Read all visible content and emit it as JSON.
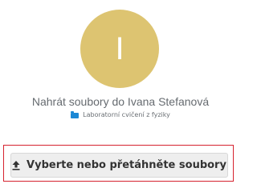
{
  "avatar": {
    "initial": "I"
  },
  "title": "Nahrát soubory do Ivana Stefanová",
  "folder": {
    "label": "Laboratorní cvičení z fyziky",
    "icon": "folder-icon"
  },
  "upload": {
    "label": "Vyberte nebo přetáhněte soubory",
    "icon": "upload-icon"
  },
  "colors": {
    "avatar": "#ddc471",
    "folder": "#1c88d5",
    "highlight": "#d6222f",
    "button_bg": "#eeeeee"
  }
}
